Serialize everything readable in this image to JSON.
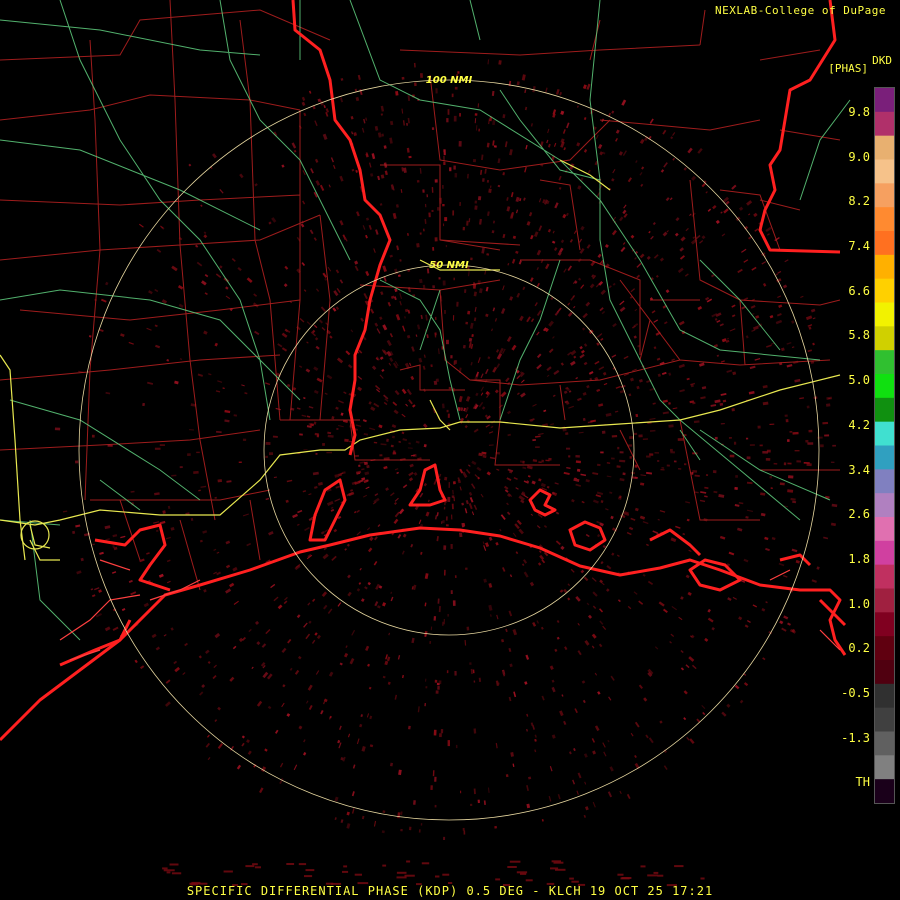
{
  "credit": "NEXLAB-College of DuPage",
  "product_code": "DKD",
  "units": "[PHAS]",
  "caption": "SPECIFIC DIFFERENTIAL PHASE (KDP) 0.5 DEG - KLCH 19 OCT 25 17:21",
  "rings": {
    "inner_label": "50 NMI",
    "outer_label": "100 NMI"
  },
  "legend": {
    "labels": [
      "9.8",
      "9.0",
      "8.2",
      "7.4",
      "6.6",
      "5.8",
      "5.0",
      "4.2",
      "3.4",
      "2.6",
      "1.8",
      "1.0",
      "0.2",
      "-0.5",
      "-1.3",
      "TH"
    ],
    "colors": [
      "#7a1f7a",
      "#b0306a",
      "#e8b070",
      "#f6c28a",
      "#f6a060",
      "#ff8a30",
      "#ff7020",
      "#ffb000",
      "#ffd000",
      "#f2f200",
      "#d0d000",
      "#30c030",
      "#10e010",
      "#109010",
      "#40e0d0",
      "#30a0c0",
      "#8080c0",
      "#b080c0",
      "#e070b0",
      "#d040a0",
      "#c03060",
      "#a02040",
      "#800020",
      "#600010",
      "#500010",
      "#303030",
      "#404040",
      "#606060",
      "#808080",
      "#1a001a"
    ],
    "colors_note": "top to bottom"
  },
  "colors": {
    "background": "#000000",
    "county_lines": "#b02020",
    "state_lines": "#ff2020",
    "highways": "#60d080",
    "interstates": "#e8e850",
    "range_rings": "#e8d8a0",
    "echo": "#8a0a14",
    "text": "#ffff44"
  }
}
